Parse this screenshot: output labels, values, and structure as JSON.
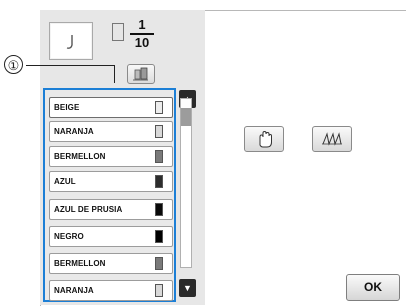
{
  "callout": {
    "number": "①"
  },
  "thread_count": {
    "current": "1",
    "total": "10"
  },
  "thread_list": [
    {
      "name": "BEIGE",
      "color": "#ececec",
      "selected": true
    },
    {
      "name": "NARANJA",
      "color": "#d9d9d9",
      "selected": false
    },
    {
      "name": "BERMELLON",
      "color": "#7a7a7a",
      "selected": false
    },
    {
      "name": "AZUL",
      "color": "#2d2d2d",
      "selected": false
    },
    {
      "name": "AZUL DE PRUSIA",
      "color": "#0a0a0a",
      "selected": false
    },
    {
      "name": "NEGRO",
      "color": "#000000",
      "selected": false
    },
    {
      "name": "BERMELLON",
      "color": "#7a7a7a",
      "selected": false
    },
    {
      "name": "NARANJA",
      "color": "#d9d9d9",
      "selected": false
    }
  ],
  "icons": {
    "preview": "stitch-preview-icon",
    "spool": "thread-spool-icon",
    "sort": "thread-sort-icon",
    "hand": "hand-move-icon",
    "stitch": "stitch-pattern-icon",
    "scroll_up": "arrow-up-icon",
    "scroll_down": "arrow-down-icon"
  },
  "scroll": {
    "up_glyph": "▲",
    "down_glyph": "▼"
  },
  "ok_label": "OK"
}
